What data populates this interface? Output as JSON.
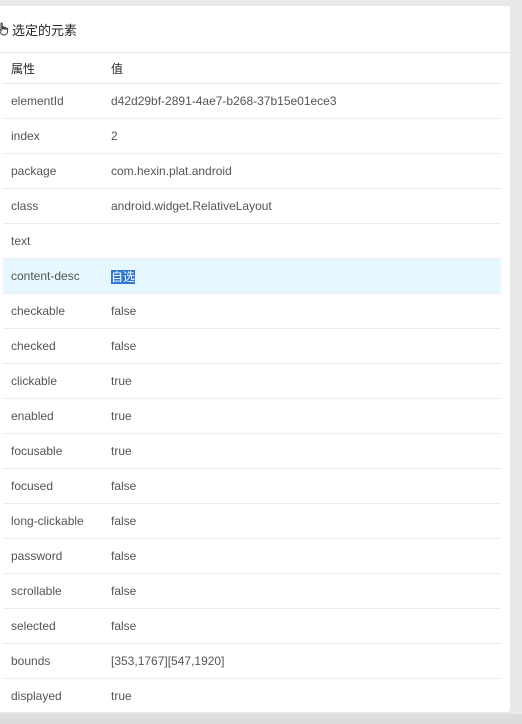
{
  "panel": {
    "title": "选定的元素",
    "icon": "hand-pointer-icon"
  },
  "table": {
    "headers": {
      "key": "属性",
      "value": "值"
    },
    "rows": [
      {
        "key": "elementId",
        "value": "d42d29bf-2891-4ae7-b268-37b15e01ece3"
      },
      {
        "key": "index",
        "value": "2"
      },
      {
        "key": "package",
        "value": "com.hexin.plat.android"
      },
      {
        "key": "class",
        "value": "android.widget.RelativeLayout"
      },
      {
        "key": "text",
        "value": ""
      },
      {
        "key": "content-desc",
        "value": "自选",
        "selected": true
      },
      {
        "key": "checkable",
        "value": "false"
      },
      {
        "key": "checked",
        "value": "false"
      },
      {
        "key": "clickable",
        "value": "true"
      },
      {
        "key": "enabled",
        "value": "true"
      },
      {
        "key": "focusable",
        "value": "true"
      },
      {
        "key": "focused",
        "value": "false"
      },
      {
        "key": "long-clickable",
        "value": "false"
      },
      {
        "key": "password",
        "value": "false"
      },
      {
        "key": "scrollable",
        "value": "false"
      },
      {
        "key": "selected",
        "value": "false"
      },
      {
        "key": "bounds",
        "value": "[353,1767][547,1920]"
      },
      {
        "key": "displayed",
        "value": "true"
      }
    ]
  },
  "colors": {
    "selected_row_bg": "#e6f7ff",
    "text_highlight": "#2f78d4"
  }
}
